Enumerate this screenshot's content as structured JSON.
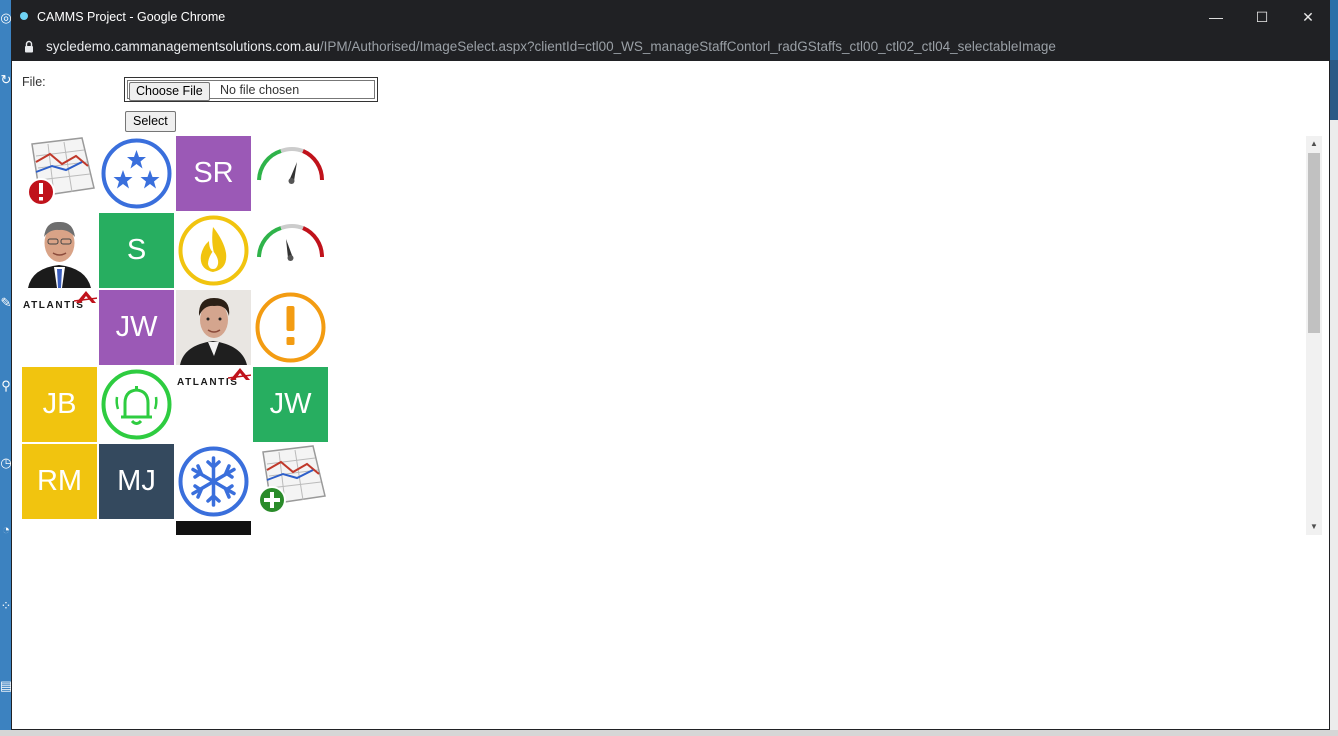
{
  "window": {
    "title": "CAMMS Project - Google Chrome",
    "minimize": "—",
    "maximize": "☐",
    "close": "✕"
  },
  "address": {
    "host": "sycledemo.cammanagementsolutions.com.au",
    "path": "/IPM/Authorised/ImageSelect.aspx?clientId=ctl00_WS_manageStaffContorl_radGStaffs_ctl00_ctl02_ctl04_selectableImage"
  },
  "form": {
    "file_label": "File:",
    "choose_file": "Choose File",
    "no_file": "No file chosen",
    "select_button": "Select"
  },
  "images": {
    "sr": "SR",
    "s": "S",
    "jw1": "JW",
    "jb": "JB",
    "jw2": "JW",
    "rm": "RM",
    "mj": "MJ",
    "atlantis1": "ATLANTIS",
    "atlantis2": "ATLANTIS"
  },
  "colors": {
    "purple": "#9b59b6",
    "green": "#27ae60",
    "yellow": "#f1c40f",
    "navy": "#34495e",
    "chrome_dark": "#202124"
  }
}
